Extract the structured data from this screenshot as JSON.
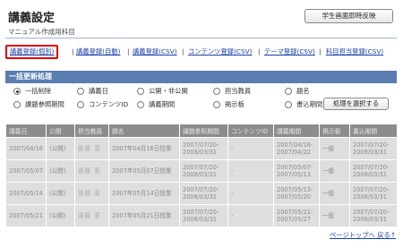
{
  "page": {
    "title": "講義設定",
    "subtitle": "マニュアル作成用科目",
    "top_button": "学生画面即時反映"
  },
  "tabs": [
    {
      "label": "講義登録(個別)",
      "active": true
    },
    {
      "label": "講義登録(自動)",
      "active": false
    },
    {
      "label": "講義登録(CSV)",
      "active": false
    },
    {
      "label": "コンテンツ登録(CSV)",
      "active": false
    },
    {
      "label": "テーマ登録(CSV)",
      "active": false
    },
    {
      "label": "科目担当登録(CSV)",
      "active": false
    }
  ],
  "bulk_update": {
    "heading": "一括更新処理",
    "options": [
      {
        "label": "一括削除",
        "selected": true
      },
      {
        "label": "講義日",
        "selected": false
      },
      {
        "label": "公開・非公開",
        "selected": false
      },
      {
        "label": "担当教員",
        "selected": false
      },
      {
        "label": "題名",
        "selected": false
      },
      {
        "label": "課題参照期間",
        "selected": false
      },
      {
        "label": "コンテンツID",
        "selected": false
      },
      {
        "label": "講義期間",
        "selected": false
      },
      {
        "label": "掲示板",
        "selected": false
      },
      {
        "label": "書込期間",
        "selected": false
      }
    ],
    "execute_button": "処理を選択する"
  },
  "table": {
    "headers": [
      "講義日",
      "公開",
      "担当教員",
      "題名",
      "課題参照期間",
      "コンテンツID",
      "講義期間",
      "掲示板",
      "書込期間"
    ],
    "rows": [
      [
        "2007/04/16",
        "(公開)",
        "遠藤 恵",
        "2007年04月16日授業",
        "2007/07/20-2008/03/31",
        "-",
        "2007/04/16-2007/04/22",
        "一般",
        "2007/07/20-2008/03/31"
      ],
      [
        "2007/05/07",
        "(公開)",
        "遠藤 恵",
        "2007年05月07日授業",
        "2007/07/20-2008/03/31",
        "-",
        "2007/05/07-2007/05/13",
        "一般",
        "2007/07/20-2008/03/31"
      ],
      [
        "2007/05/14",
        "(公開)",
        "遠藤 恵",
        "2007年05月14日授業",
        "2007/07/20-2008/03/31",
        "-",
        "2007/05/13-2007/05/20",
        "一般",
        "2007/07/20-2008/03/31"
      ],
      [
        "2007/05/21",
        "(公開)",
        "遠藤 恵",
        "2007年05月21日授業",
        "2007/07/20-2008/03/31",
        "-",
        "2007/05/21-2007/05/27",
        "一般",
        "2007/07/20-2008/03/31"
      ]
    ]
  },
  "footer": {
    "back_to_top": "ページトップへ 戻る↑"
  }
}
